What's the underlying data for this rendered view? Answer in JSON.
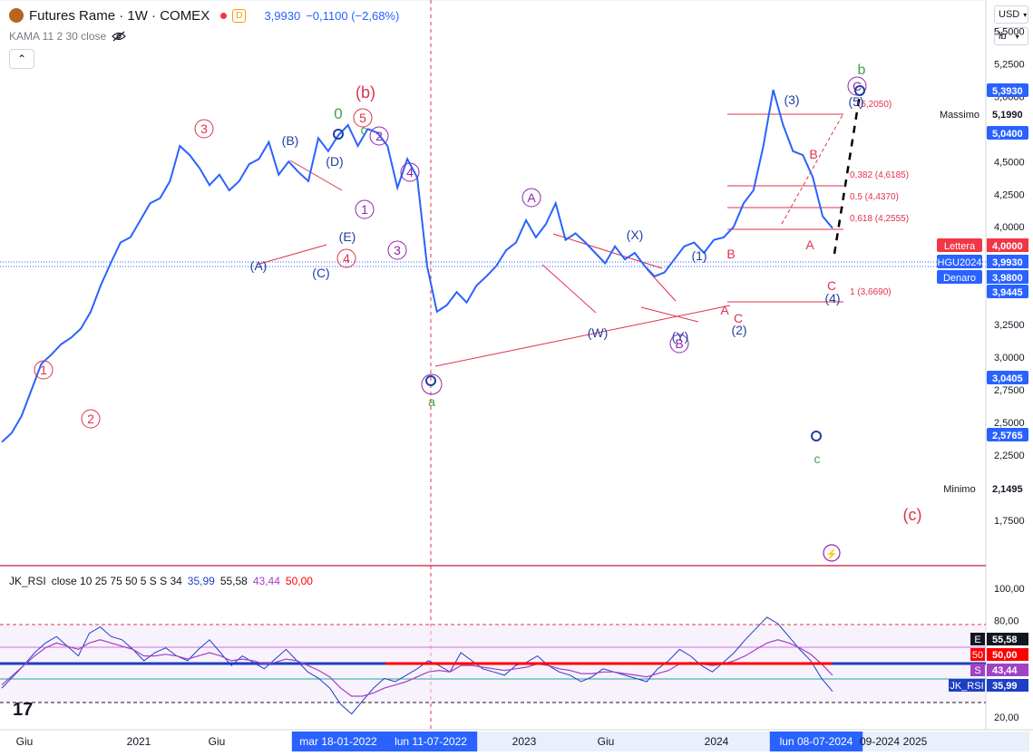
{
  "header": {
    "symbol_title": "Futures Rame · 1W · COMEX",
    "badge_d": "D",
    "price": "3,9930",
    "change": "−0,1100 (−2,68%)"
  },
  "indicator_label": "KAMA 11 2 30 close",
  "controls": {
    "currency": "USD",
    "unit": "lb"
  },
  "rsi_legend": {
    "name": "JK_RSI",
    "params": "close 10 25 75 50 5 S S 34",
    "v1": "35,99",
    "v2": "55,58",
    "v3": "43,44",
    "v4": "50,00"
  },
  "colors": {
    "price_line": "#2962ff",
    "wave_blue": "#1f3fa3",
    "wave_red": "#e0314b",
    "wave_purple": "#8e24aa",
    "wave_green": "#43a047",
    "fib": "#e0314b",
    "rsi_purple": "#a042c4",
    "rsi_blue": "#1e3fc4",
    "rsi_red": "#ff0000"
  },
  "chart_data": [
    {
      "type": "line",
      "series": [
        {
          "values": [
            2.35,
            2.42,
            2.55,
            2.75,
            2.95,
            3.02,
            3.1,
            3.15,
            3.22,
            3.35,
            3.55,
            3.72,
            3.88,
            3.92,
            4.05,
            4.18,
            4.22,
            4.35,
            4.62,
            4.55,
            4.45,
            4.32,
            4.4,
            4.28,
            4.35,
            4.48,
            4.52,
            4.65,
            4.4,
            4.5,
            4.42,
            4.35,
            4.68,
            4.58,
            4.7,
            4.78,
            4.62,
            4.75,
            4.72,
            4.62,
            4.3,
            4.52,
            4.38,
            3.7,
            3.35,
            3.4,
            3.5,
            3.42,
            3.55,
            3.62,
            3.7,
            3.82,
            3.88,
            4.05,
            3.92,
            4.02,
            4.18,
            3.9,
            3.95,
            3.88,
            3.8,
            3.72,
            3.85,
            3.75,
            3.8,
            3.7,
            3.62,
            3.65,
            3.75,
            3.85,
            3.88,
            3.8,
            3.9,
            3.92,
            4.0,
            4.18,
            4.28,
            4.62,
            5.05,
            4.78,
            4.58,
            4.55,
            4.38,
            4.08,
            3.99
          ]
        }
      ],
      "ylim": [
        1.5,
        5.6
      ],
      "y_ticks": [
        "5,5000",
        "5,2500",
        "5,0000",
        "4,7500",
        "4,5000",
        "4,2500",
        "4,0000",
        "3,7500",
        "3,5000",
        "3,2500",
        "3,0000",
        "2,7500",
        "2,5000",
        "2,2500",
        "2,0000",
        "1,7500"
      ],
      "x_ticks": [
        "Giu",
        "2021",
        "Giu",
        "mar 18-01-2022",
        "lun 11-07-2022",
        "2023",
        "Giu",
        "2024",
        "lun 08-07-2024",
        "09-2024",
        "2025"
      ],
      "price_labels": [
        {
          "text": "5,3930",
          "bg": "#2962ff",
          "fg": "#ffffff"
        },
        {
          "text": "Massimo",
          "bg": "#ffffff",
          "fg": "#131722",
          "extra": "5,1990"
        },
        {
          "text": "5,0400",
          "bg": "#2962ff",
          "fg": "#ffffff"
        },
        {
          "text": "Lettera",
          "bg": "#f23645",
          "fg": "#ffffff",
          "extra": "4,0000"
        },
        {
          "text": "HGU2024",
          "bg": "#2962ff",
          "fg": "#ffffff",
          "extra": "3,9930"
        },
        {
          "text": "Denaro",
          "bg": "#2962ff",
          "fg": "#ffffff",
          "extra": "3,9800"
        },
        {
          "text": "3,9445",
          "bg": "#2962ff",
          "fg": "#ffffff"
        },
        {
          "text": "3,0405",
          "bg": "#2962ff",
          "fg": "#ffffff"
        },
        {
          "text": "2,5765",
          "bg": "#2962ff",
          "fg": "#ffffff"
        },
        {
          "text": "Minimo",
          "bg": "#ffffff",
          "fg": "#131722",
          "extra": "2,1495"
        }
      ],
      "fib_levels": [
        "(5,2050)",
        "0,382 (4,6185)",
        "0,5 (4,4370)",
        "0,618 (4,2555)",
        "1 (3,6690)"
      ],
      "wave_labels": {
        "red_circled": [
          "1",
          "2",
          "3",
          "4",
          "5"
        ],
        "purple_circled": [
          "1",
          "2",
          "3",
          "4",
          "A",
          "B",
          "C"
        ],
        "blue_paren": [
          "(A)",
          "(B)",
          "(C)",
          "(D)",
          "(E)",
          "(W)",
          "(X)",
          "(Y)",
          "(1)",
          "(2)",
          "(3)",
          "(4)",
          "(5)"
        ],
        "red_plain": [
          "(b)",
          "(c)",
          "A",
          "B",
          "C"
        ],
        "green": [
          "0",
          "c",
          "a",
          "b"
        ]
      }
    },
    {
      "type": "line",
      "title": "JK_RSI",
      "ylim": [
        15,
        105
      ],
      "y_ticks": [
        "100,00",
        "80,00",
        "20,00"
      ],
      "levels": [
        {
          "label": "E",
          "value": "55,58",
          "bg": "#131722"
        },
        {
          "label": "50",
          "value": "50,00",
          "bg": "#ff0000"
        },
        {
          "label": "S",
          "value": "43,44",
          "bg": "#a042c4"
        },
        {
          "label": "JK_RSI",
          "value": "35,99",
          "bg": "#1e3fc4"
        }
      ],
      "series": [
        {
          "name": "RSI",
          "values": [
            38,
            45,
            52,
            60,
            66,
            70,
            64,
            58,
            72,
            76,
            70,
            68,
            62,
            55,
            60,
            63,
            58,
            55,
            62,
            68,
            60,
            52,
            58,
            54,
            50,
            56,
            62,
            55,
            48,
            44,
            38,
            28,
            22,
            30,
            38,
            44,
            42,
            46,
            50,
            55,
            52,
            48,
            60,
            55,
            50,
            48,
            46,
            52,
            54,
            58,
            52,
            48,
            46,
            42,
            45,
            50,
            48,
            46,
            44,
            42,
            50,
            55,
            62,
            58,
            52,
            48,
            54,
            60,
            68,
            75,
            82,
            78,
            70,
            62,
            55,
            44,
            36
          ]
        },
        {
          "name": "Signal",
          "values": [
            40,
            46,
            52,
            58,
            63,
            66,
            64,
            62,
            66,
            68,
            66,
            64,
            62,
            58,
            58,
            59,
            58,
            56,
            58,
            60,
            58,
            55,
            56,
            55,
            53,
            54,
            56,
            55,
            52,
            49,
            45,
            38,
            33,
            33,
            35,
            38,
            40,
            42,
            45,
            48,
            49,
            48,
            52,
            52,
            51,
            50,
            49,
            50,
            51,
            53,
            52,
            50,
            49,
            47,
            47,
            48,
            48,
            47,
            46,
            45,
            47,
            49,
            53,
            54,
            53,
            52,
            53,
            55,
            58,
            62,
            66,
            68,
            66,
            63,
            59,
            53,
            46
          ]
        }
      ]
    }
  ]
}
